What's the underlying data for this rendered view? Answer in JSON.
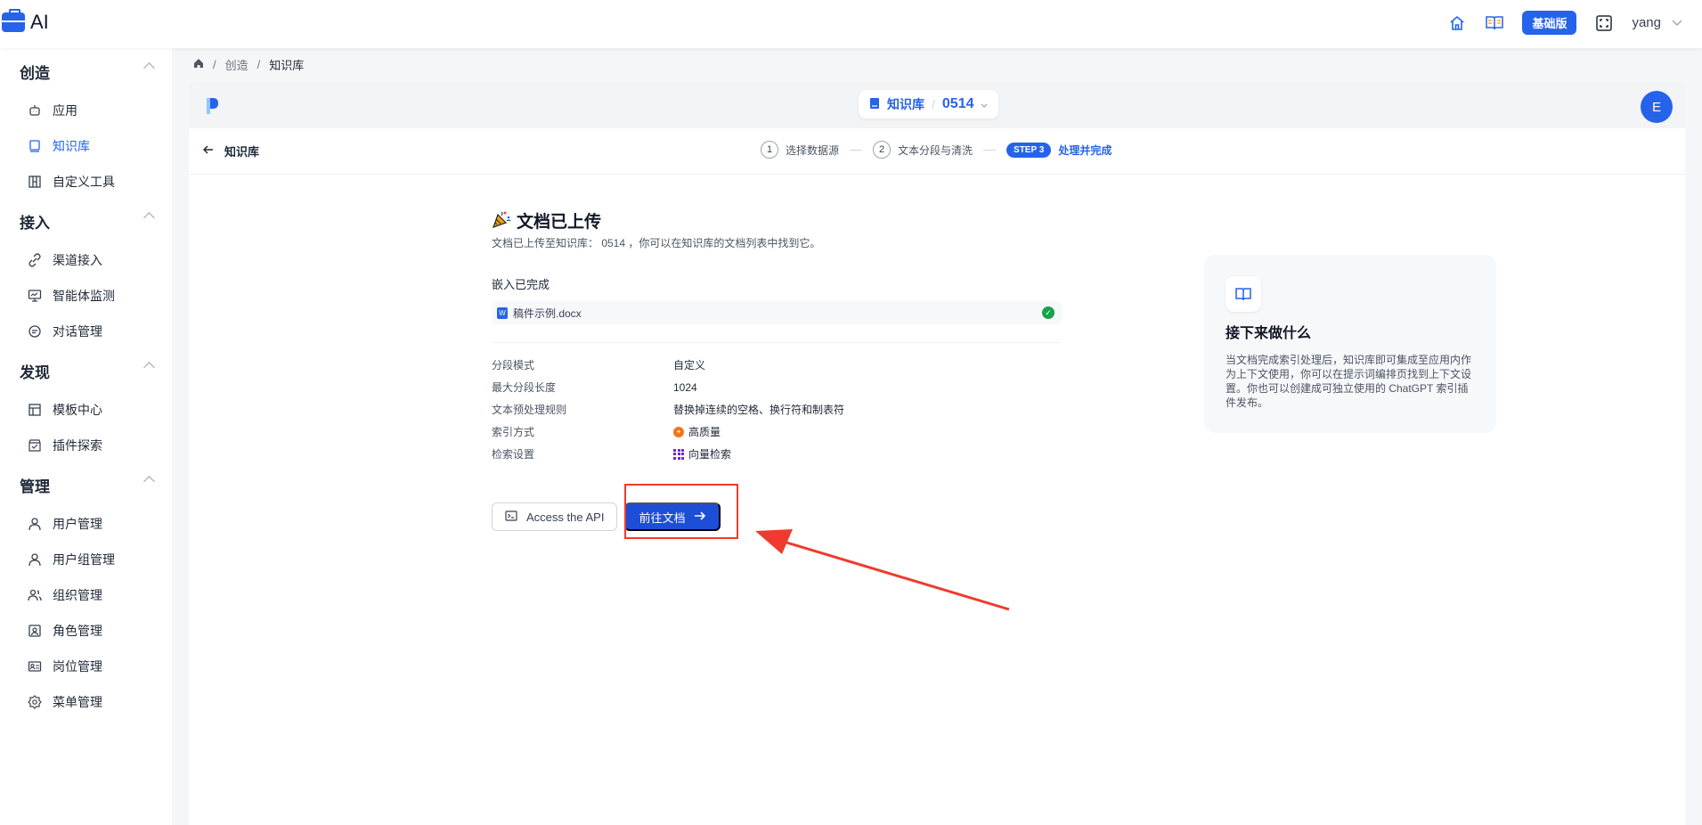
{
  "app": {
    "logo_text": "AI"
  },
  "topbar": {
    "plan_badge": "基础版",
    "user_name": "yang"
  },
  "sidebar": {
    "sections": [
      {
        "title": "创造",
        "items": [
          {
            "label": "应用"
          },
          {
            "label": "知识库",
            "active": true
          },
          {
            "label": "自定义工具"
          }
        ]
      },
      {
        "title": "接入",
        "items": [
          {
            "label": "渠道接入"
          },
          {
            "label": "智能体监测"
          },
          {
            "label": "对话管理"
          }
        ]
      },
      {
        "title": "发现",
        "items": [
          {
            "label": "模板中心"
          },
          {
            "label": "插件探索"
          }
        ]
      },
      {
        "title": "管理",
        "items": [
          {
            "label": "用户管理"
          },
          {
            "label": "用户组管理"
          },
          {
            "label": "组织管理"
          },
          {
            "label": "角色管理"
          },
          {
            "label": "岗位管理"
          },
          {
            "label": "菜单管理"
          }
        ]
      }
    ]
  },
  "breadcrumb": {
    "items": [
      "创造",
      "知识库"
    ]
  },
  "header": {
    "kb_label": "知识库",
    "kb_id": "0514",
    "avatar_letter": "E"
  },
  "stepbar": {
    "back_label": "知识库",
    "steps": [
      {
        "num": "1",
        "label": "选择数据源"
      },
      {
        "num": "2",
        "label": "文本分段与清洗"
      }
    ],
    "active_badge": "STEP 3",
    "active_label": "处理并完成"
  },
  "result": {
    "title": "文档已上传",
    "subtitle": "文档已上传至知识库： 0514 ，你可以在知识库的文档列表中找到它。",
    "embed_label": "嵌入已完成",
    "file_name": "稿件示例.docx",
    "info": [
      {
        "key": "分段模式",
        "value": "自定义"
      },
      {
        "key": "最大分段长度",
        "value": "1024"
      },
      {
        "key": "文本预处理规则",
        "value": "替换掉连续的空格、换行符和制表符"
      },
      {
        "key": "索引方式",
        "value": "高质量",
        "icon": "high-quality-icon"
      },
      {
        "key": "检索设置",
        "value": "向量检索",
        "icon": "vector-grid-icon"
      }
    ],
    "api_button": "Access the API",
    "go_button": "前往文档"
  },
  "tip": {
    "title": "接下来做什么",
    "body": "当文档完成索引处理后，知识库即可集成至应用内作为上下文使用，你可以在提示词编排页找到上下文设置。你也可以创建成可独立使用的 ChatGPT 索引插件发布。"
  },
  "colors": {
    "accent": "#2563eb",
    "annotation": "#ef3b2d",
    "success": "#16a34a"
  }
}
